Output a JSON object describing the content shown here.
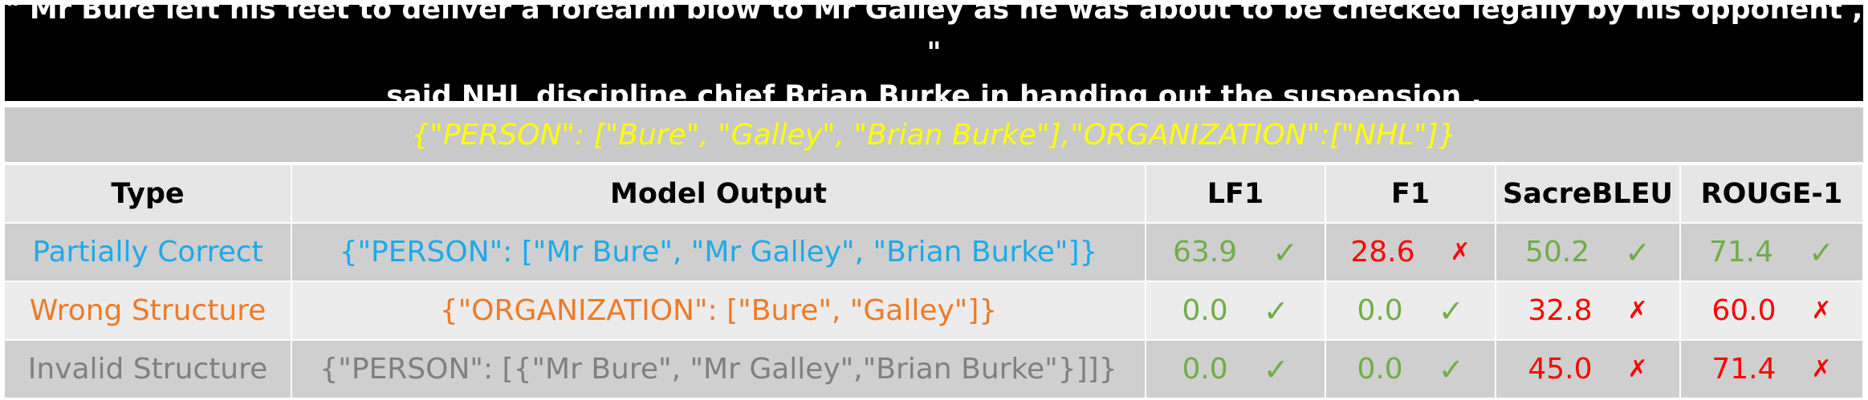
{
  "banner": {
    "line1": "\" Mr Bure left his feet to deliver a forearm blow to Mr Galley as he was about to be checked legally by his opponent , \"",
    "line2": "said NHL discipline chief Brian Burke in handing out the suspension ."
  },
  "ground_truth": "{\"PERSON\": [\"Bure\", \"Galley\", \"Brian Burke\"],\"ORGANIZATION\":[\"NHL\"]}",
  "table": {
    "headers": [
      "Type",
      "Model Output",
      "LF1",
      "F1",
      "SacreBLEU",
      "ROUGE-1"
    ],
    "rows": [
      {
        "type": "Partially Correct",
        "output": "{\"PERSON\": [\"Mr Bure\", \"Mr Galley\", \"Brian Burke\"]}",
        "lf1": "63.9",
        "lf1_mark": "✓",
        "f1": "28.6",
        "f1_mark": "✗",
        "sacrebleu": "50.2",
        "sacrebleu_mark": "✓",
        "rouge1": "71.4",
        "rouge1_mark": "✓"
      },
      {
        "type": "Wrong Structure",
        "output": "{\"ORGANIZATION\": [\"Bure\", \"Galley\"]}",
        "lf1": "0.0",
        "lf1_mark": "✓",
        "f1": "0.0",
        "f1_mark": "✓",
        "sacrebleu": "32.8",
        "sacrebleu_mark": "✗",
        "rouge1": "60.0",
        "rouge1_mark": "✗"
      },
      {
        "type": "Invalid Structure",
        "output": "{\"PERSON\": [{\"Mr Bure\", \"Mr Galley\",\"Brian Burke\"}]]}",
        "lf1": "0.0",
        "lf1_mark": "✓",
        "f1": "0.0",
        "f1_mark": "✓",
        "sacrebleu": "45.0",
        "sacrebleu_mark": "✗",
        "rouge1": "71.4",
        "rouge1_mark": "✗"
      }
    ]
  },
  "colors": {
    "partial": "#1eaae8",
    "wrong": "#ee7b26",
    "invalid": "#808080",
    "good": "#70ad47",
    "bad": "#ff0000",
    "ground_truth": "#ffff00"
  }
}
